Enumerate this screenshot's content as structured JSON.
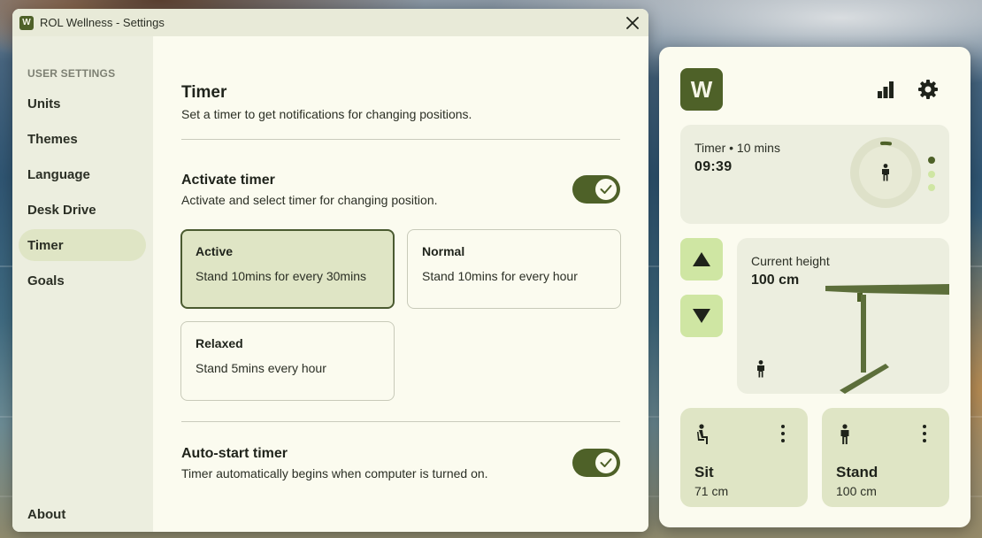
{
  "window": {
    "logo_letter": "W",
    "title": "ROL Wellness - Settings"
  },
  "sidebar": {
    "header": "USER SETTINGS",
    "items": [
      {
        "label": "Units"
      },
      {
        "label": "Themes"
      },
      {
        "label": "Language"
      },
      {
        "label": "Desk Drive"
      },
      {
        "label": "Timer"
      },
      {
        "label": "Goals"
      }
    ],
    "active": "Timer",
    "footer": "About"
  },
  "content": {
    "title": "Timer",
    "subtitle": "Set a timer to get notifications for changing positions.",
    "activate": {
      "title": "Activate timer",
      "description": "Activate and select timer for changing position.",
      "enabled": true
    },
    "options": [
      {
        "name": "Active",
        "description": "Stand 10mins for every 30mins",
        "selected": true
      },
      {
        "name": "Normal",
        "description": "Stand 10mins for every hour",
        "selected": false
      },
      {
        "name": "Relaxed",
        "description": "Stand 5mins every hour",
        "selected": false
      }
    ],
    "autostart": {
      "title": "Auto-start timer",
      "description": "Timer automatically begins when computer is turned on.",
      "enabled": true
    }
  },
  "widget": {
    "logo_letter": "W",
    "timer": {
      "label": "Timer • 10 mins",
      "remaining": "09:39"
    },
    "height": {
      "label": "Current height",
      "value": "100 cm"
    },
    "presets": [
      {
        "name": "Sit",
        "height": "71 cm"
      },
      {
        "name": "Stand",
        "height": "100 cm"
      }
    ]
  },
  "colors": {
    "accent": "#4e6128",
    "selected_bg": "#dfe5c5",
    "button_green": "#cfe6a3",
    "background": "#fbfbef"
  },
  "icons": [
    "close-icon",
    "bar-chart-icon",
    "gear-icon",
    "standing-person-icon",
    "sitting-person-icon",
    "arrow-up-icon",
    "arrow-down-icon",
    "more-vertical-icon",
    "check-icon"
  ]
}
